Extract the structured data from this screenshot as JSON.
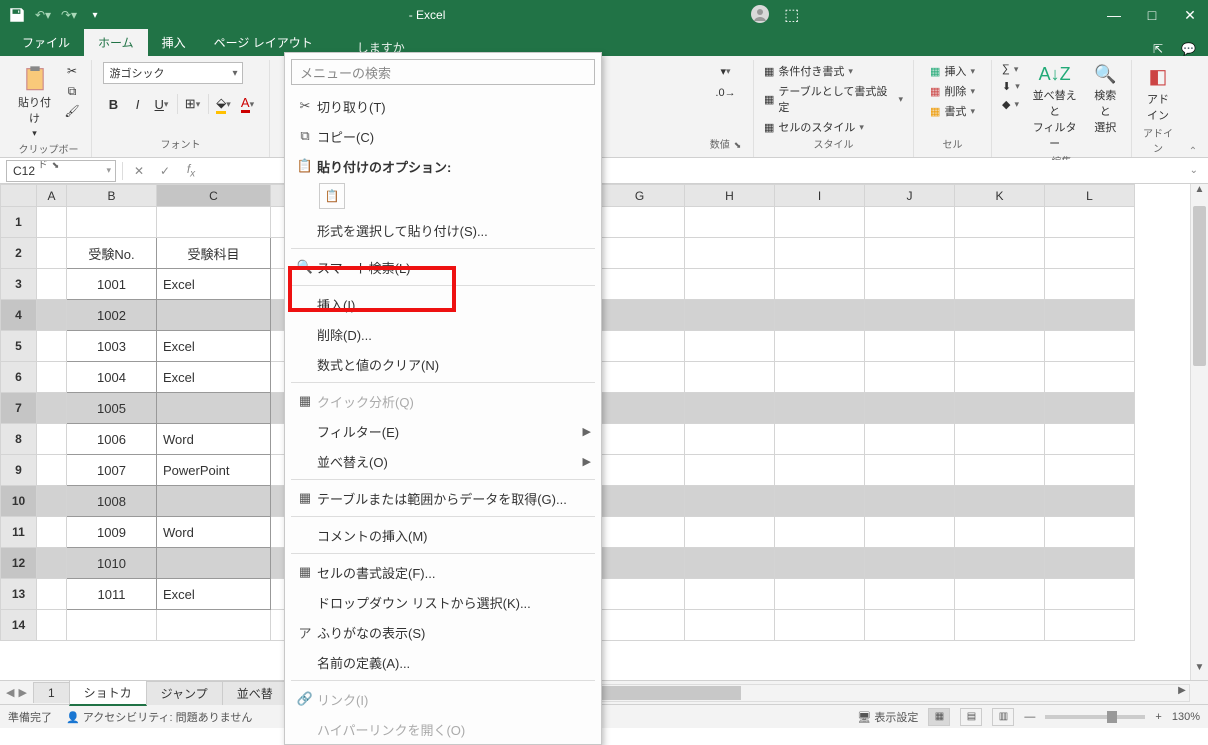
{
  "titlebar": {
    "app_title": "- Excel"
  },
  "tabs": {
    "file": "ファイル",
    "home": "ホーム",
    "insert": "挿入",
    "page_layout": "ページ レイアウト",
    "tell_me": "しますか"
  },
  "ribbon": {
    "clipboard": {
      "label": "クリップボード",
      "paste": "貼り付け"
    },
    "font": {
      "label": "フォント",
      "name": "游ゴシック"
    },
    "number": {
      "label": "数値"
    },
    "styles": {
      "label": "スタイル",
      "conditional": "条件付き書式",
      "as_table": "テーブルとして書式設定",
      "cell_styles": "セルのスタイル"
    },
    "cells": {
      "label": "セル",
      "insert": "挿入",
      "delete": "削除",
      "format": "書式"
    },
    "editing": {
      "label": "編集",
      "sort_filter": "並べ替えと\nフィルター",
      "find_select": "検索と\n選択"
    },
    "addins": {
      "label": "アドイン",
      "addin": "アド\nイン"
    }
  },
  "name_box": "C12",
  "columns": [
    "A",
    "B",
    "C",
    "G",
    "H",
    "I",
    "J",
    "K",
    "L"
  ],
  "table": {
    "headers": {
      "b": "受験No.",
      "c": "受験科目"
    },
    "rows": [
      {
        "n": "1001",
        "s": "Excel"
      },
      {
        "n": "1002",
        "s": "",
        "sel": true
      },
      {
        "n": "1003",
        "s": "Excel"
      },
      {
        "n": "1004",
        "s": "Excel"
      },
      {
        "n": "1005",
        "s": "",
        "sel": true
      },
      {
        "n": "1006",
        "s": "Word"
      },
      {
        "n": "1007",
        "s": "PowerPoint"
      },
      {
        "n": "1008",
        "s": "",
        "sel": true
      },
      {
        "n": "1009",
        "s": "Word"
      },
      {
        "n": "1010",
        "s": "",
        "sel": true
      },
      {
        "n": "1011",
        "s": "Excel"
      }
    ]
  },
  "sheet_tabs": {
    "t1": "1",
    "t2": "ショトカ",
    "t3": "ジャンプ",
    "t4": "並べ替"
  },
  "status": {
    "ready": "準備完了",
    "accessibility": "アクセシビリティ: 問題ありません",
    "display_settings": "表示設定",
    "zoom": "130%"
  },
  "context_menu": {
    "search_placeholder": "メニューの検索",
    "cut": "切り取り(T)",
    "copy": "コピー(C)",
    "paste_options": "貼り付けのオプション:",
    "paste_special": "形式を選択して貼り付け(S)...",
    "smart_lookup": "スマート検索(L)",
    "insert": "挿入(I)...",
    "delete": "削除(D)...",
    "clear": "数式と値のクリア(N)",
    "quick_analysis": "クイック分析(Q)",
    "filter": "フィルター(E)",
    "sort": "並べ替え(O)",
    "get_data": "テーブルまたは範囲からデータを取得(G)...",
    "insert_comment": "コメントの挿入(M)",
    "format_cells": "セルの書式設定(F)...",
    "pick_from_list": "ドロップダウン リストから選択(K)...",
    "show_phonetic": "ふりがなの表示(S)",
    "define_name": "名前の定義(A)...",
    "link": "リンク(I)",
    "open_hyperlink": "ハイパーリンクを開く(O)"
  }
}
